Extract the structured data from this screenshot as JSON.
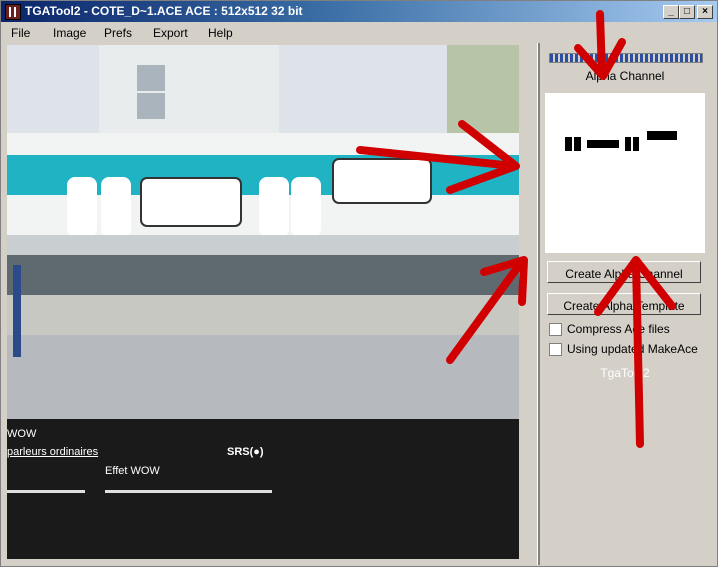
{
  "window": {
    "title": "TGATool2 - COTE_D~1.ACE   ACE : 512x512 32 bit",
    "controls": {
      "minimize": "_",
      "maximize": "□",
      "close": "×"
    }
  },
  "menu": [
    "File",
    "Image",
    "Prefs",
    "Export",
    "Help"
  ],
  "overlay_panel": {
    "line1": "WOW",
    "line2": "parleurs ordinaires",
    "brand": "SRS(●)",
    "effect_label": "Effet WOW"
  },
  "sidebar": {
    "alpha_label": "Alpha Channel",
    "create_alpha_button": "Create Alpha Channel",
    "create_template_button": "Create Alpha Template",
    "checkboxes": [
      {
        "label": "Compress Ace files",
        "checked": false
      },
      {
        "label": "Using updated MakeAce",
        "checked": false
      }
    ],
    "footer": "TgaTool2"
  },
  "colors": {
    "annotation_red": "#d10000",
    "tram_teal": "#1fb3c4"
  }
}
